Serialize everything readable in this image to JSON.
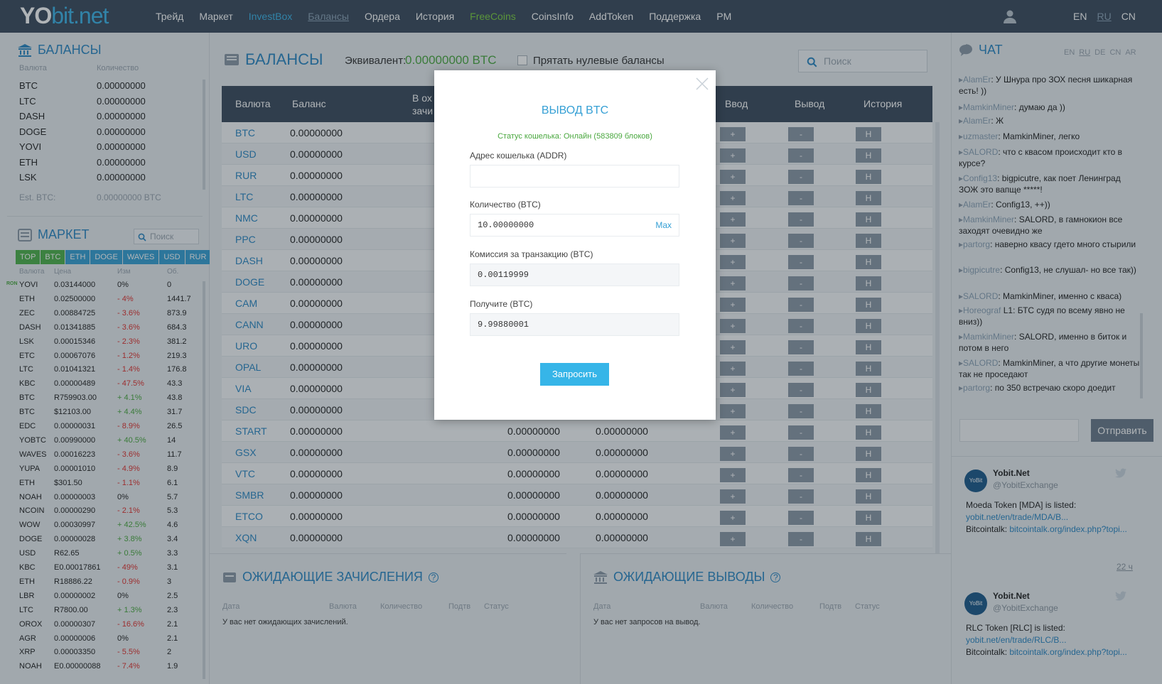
{
  "header": {
    "logo_prefix": "YO",
    "logo_suffix": "bit.net",
    "nav": [
      "Трейд",
      "Маркет",
      "InvestBox",
      "Балансы",
      "Ордера",
      "История",
      "FreeCoins",
      "CoinsInfo",
      "AddToken",
      "Поддержка",
      "PM"
    ],
    "langs": [
      "EN",
      "RU",
      "CN"
    ]
  },
  "balances_panel": {
    "title": "БАЛАНСЫ",
    "col_currency": "Валюта",
    "col_amount": "Количество",
    "rows": [
      {
        "cur": "BTC",
        "amt": "0.00000000"
      },
      {
        "cur": "LTC",
        "amt": "0.00000000"
      },
      {
        "cur": "DASH",
        "amt": "0.00000000"
      },
      {
        "cur": "DOGE",
        "amt": "0.00000000"
      },
      {
        "cur": "YOVI",
        "amt": "0.00000000"
      },
      {
        "cur": "ETH",
        "amt": "0.00000000"
      },
      {
        "cur": "LSK",
        "amt": "0.00000000"
      }
    ],
    "est_label": "Est. BTC:",
    "est_value": "0.00000000 BTC"
  },
  "market_panel": {
    "title": "МАРКЕТ",
    "search_placeholder": "Поиск",
    "tabs": [
      "TOP",
      "BTC",
      "ETH",
      "DOGE",
      "WAVES",
      "USD",
      "RUR"
    ],
    "col_cur": "Валюта",
    "col_price": "Цена",
    "col_change": "Изм",
    "col_vol": "Об.",
    "rows": [
      {
        "cur": "YOVI",
        "price": "0.03144000",
        "chg": "0%",
        "vol": "0"
      },
      {
        "cur": "ETH",
        "price": "0.02500000",
        "chg": "- 4%",
        "vol": "1441.7"
      },
      {
        "cur": "ZEC",
        "price": "0.00884725",
        "chg": "- 3.6%",
        "vol": "873.9"
      },
      {
        "cur": "DASH",
        "price": "0.01341885",
        "chg": "- 3.6%",
        "vol": "684.3"
      },
      {
        "cur": "LSK",
        "price": "0.00015346",
        "chg": "- 2.3%",
        "vol": "381.2"
      },
      {
        "cur": "ETC",
        "price": "0.00067076",
        "chg": "- 1.2%",
        "vol": "219.3"
      },
      {
        "cur": "LTC",
        "price": "0.01041321",
        "chg": "- 1.4%",
        "vol": "176.8"
      },
      {
        "cur": "KBC",
        "price": "0.00000489",
        "chg": "- 47.5%",
        "vol": "43.3"
      },
      {
        "cur": "BTC",
        "price": "R759903.00",
        "chg": "+ 4.1%",
        "vol": "43.8"
      },
      {
        "cur": "BTC",
        "price": "$12103.00",
        "chg": "+ 4.4%",
        "vol": "31.7"
      },
      {
        "cur": "EDC",
        "price": "0.00000031",
        "chg": "- 8.9%",
        "vol": "26.5"
      },
      {
        "cur": "YOBTC",
        "price": "0.00990000",
        "chg": "+ 40.5%",
        "vol": "14"
      },
      {
        "cur": "WAVES",
        "price": "0.00016223",
        "chg": "- 3.6%",
        "vol": "11.7"
      },
      {
        "cur": "YUPA",
        "price": "0.00001010",
        "chg": "- 4.9%",
        "vol": "8.9"
      },
      {
        "cur": "ETH",
        "price": "$301.50",
        "chg": "- 1.1%",
        "vol": "6.1"
      },
      {
        "cur": "NOAH",
        "price": "0.00000003",
        "chg": "0%",
        "vol": "5.7"
      },
      {
        "cur": "NCOIN",
        "price": "0.00000290",
        "chg": "- 2.1%",
        "vol": "5.3"
      },
      {
        "cur": "WOW",
        "price": "0.00030997",
        "chg": "+ 42.5%",
        "vol": "4.6"
      },
      {
        "cur": "DOGE",
        "price": "0.00000028",
        "chg": "+ 3.8%",
        "vol": "3.4"
      },
      {
        "cur": "USD",
        "price": "R62.65",
        "chg": "+ 0.5%",
        "vol": "3.3"
      },
      {
        "cur": "KBC",
        "price": "E0.00017861",
        "chg": "- 49%",
        "vol": "3.1"
      },
      {
        "cur": "ETH",
        "price": "R18886.22",
        "chg": "- 0.9%",
        "vol": "3"
      },
      {
        "cur": "LBR",
        "price": "0.00000002",
        "chg": "0%",
        "vol": "2.5"
      },
      {
        "cur": "LTC",
        "price": "R7800.00",
        "chg": "+ 1.3%",
        "vol": "2.3"
      },
      {
        "cur": "OROX",
        "price": "0.00000307",
        "chg": "- 16.6%",
        "vol": "2.1"
      },
      {
        "cur": "AGR",
        "price": "0.00000006",
        "chg": "0%",
        "vol": "2.1"
      },
      {
        "cur": "XRP",
        "price": "0.00003350",
        "chg": "- 5.5%",
        "vol": "2"
      },
      {
        "cur": "NOAH",
        "price": "E0.00000088",
        "chg": "- 7.4%",
        "vol": "1.9"
      }
    ],
    "ron_badge": "RON"
  },
  "main": {
    "title": "БАЛАНСЫ",
    "equiv_label": "Эквивалент:",
    "equiv_value": "0.00000000 BTC",
    "hide_zero": "Прятать нулевые балансы",
    "search_placeholder": "Поиск",
    "cols": {
      "cur": "Валюта",
      "bal": "Баланс",
      "inorders": "В ох",
      "inorders2": "зачи",
      "dep": "Ввод",
      "wd": "Вывод",
      "hist": "История"
    },
    "btn_plus": "+",
    "btn_minus": "-",
    "btn_hist": "H",
    "rows": [
      {
        "cur": "BTC",
        "bal": "0.00000000",
        "c3": "",
        "c4": ""
      },
      {
        "cur": "USD",
        "bal": "0.00000000",
        "c3": "",
        "c4": ""
      },
      {
        "cur": "RUR",
        "bal": "0.00000000",
        "c3": "",
        "c4": ""
      },
      {
        "cur": "LTC",
        "bal": "0.00000000",
        "c3": "",
        "c4": ""
      },
      {
        "cur": "NMC",
        "bal": "0.00000000",
        "c3": "",
        "c4": ""
      },
      {
        "cur": "PPC",
        "bal": "0.00000000",
        "c3": "",
        "c4": ""
      },
      {
        "cur": "DASH",
        "bal": "0.00000000",
        "c3": "",
        "c4": ""
      },
      {
        "cur": "DOGE",
        "bal": "0.00000000",
        "c3": "",
        "c4": ""
      },
      {
        "cur": "CAM",
        "bal": "0.00000000",
        "c3": "",
        "c4": ""
      },
      {
        "cur": "CANN",
        "bal": "0.00000000",
        "c3": "",
        "c4": ""
      },
      {
        "cur": "URO",
        "bal": "0.00000000",
        "c3": "",
        "c4": ""
      },
      {
        "cur": "OPAL",
        "bal": "0.00000000",
        "c3": "",
        "c4": ""
      },
      {
        "cur": "VIA",
        "bal": "0.00000000",
        "c3": "",
        "c4": ""
      },
      {
        "cur": "SDC",
        "bal": "0.00000000",
        "c3": "",
        "c4": ""
      },
      {
        "cur": "START",
        "bal": "0.00000000",
        "c3": "0.00000000",
        "c4": "0.00000000"
      },
      {
        "cur": "GSX",
        "bal": "0.00000000",
        "c3": "0.00000000",
        "c4": "0.00000000"
      },
      {
        "cur": "VTC",
        "bal": "0.00000000",
        "c3": "0.00000000",
        "c4": "0.00000000"
      },
      {
        "cur": "SMBR",
        "bal": "0.00000000",
        "c3": "0.00000000",
        "c4": "0.00000000"
      },
      {
        "cur": "ETCO",
        "bal": "0.00000000",
        "c3": "0.00000000",
        "c4": "0.00000000"
      },
      {
        "cur": "XQN",
        "bal": "0.00000000",
        "c3": "0.00000000",
        "c4": "0.00000000"
      }
    ]
  },
  "pending_deposits": {
    "title": "ОЖИДАЮЩИЕ ЗАЧИСЛЕНИЯ",
    "cols": [
      "Дата",
      "Валюта",
      "Количество",
      "Подтв",
      "Статус"
    ],
    "empty": "У вас нет ожидающих зачислений."
  },
  "pending_withdrawals": {
    "title": "ОЖИДАЮЩИЕ ВЫВОДЫ",
    "cols": [
      "Дата",
      "Валюта",
      "Количество",
      "Подтв",
      "Статус"
    ],
    "empty": "У вас нет запросов на вывод."
  },
  "modal": {
    "title": "ВЫВОД BTC",
    "status": "Статус кошелька: Онлайн (583809 блоков)",
    "addr_label": "Адрес кошелька (ADDR)",
    "addr_value": "",
    "qty_label": "Количество (BTC)",
    "qty_value": "10.00000000",
    "max_label": "Max",
    "fee_label": "Комиссия за транзакцию (BTC)",
    "fee_value": "0.00119999",
    "recv_label": "Получите (BTC)",
    "recv_value": "9.99880001",
    "submit": "Запросить"
  },
  "chat": {
    "title": "ЧАТ",
    "langs": [
      "EN",
      "RU",
      "DE",
      "CN",
      "AR"
    ],
    "messages": [
      {
        "user": "AlamEr",
        "text": ": У Шнура про ЗОХ песня шикарная есть! ))"
      },
      {
        "user": "MamkinMiner",
        "text": ": думаю да ))"
      },
      {
        "user": "AlamEr",
        "text": ": Ж"
      },
      {
        "user": "uzmaster",
        "text": ": MamkinMiner, легко"
      },
      {
        "user": "SALORD",
        "text": ": что с квасом происходит кто в курсе?"
      },
      {
        "user": "Config13",
        "text": ": bigpicutre, как поет Ленинград ЗОЖ это вапще *****!"
      },
      {
        "user": "AlamEr",
        "text": ": Config13, ++))"
      },
      {
        "user": "MamkinMiner",
        "text": ": SALORD, в гамнокион все заходят очевидно же"
      },
      {
        "user": "partorg",
        "text": ": наверно квасу гдето много стырили"
      },
      {
        "user": "bigpicutre",
        "text": ": Config13, не слушал- но все так))"
      },
      {
        "user": "SALORD",
        "text": ": MamkinMiner, именно с кваса)"
      },
      {
        "user": "Horeograf",
        "text": " L1: БТС судя по всему явно не вниз))"
      },
      {
        "user": "MamkinMiner",
        "text": ": SALORD, именно в биток и потом в него"
      },
      {
        "user": "SALORD",
        "text": ": MamkinMiner, а что другие монеты так не проседают"
      },
      {
        "user": "partorg",
        "text": ": по 350 встречаю скоро доедит"
      }
    ],
    "send": "Отправить"
  },
  "tweets": [
    {
      "name": "Yobit.Net",
      "handle": "@YobitExchange",
      "text": "Moeda Token [MDA] is listed: ",
      "link": "yobit.net/en/trade/MDA/B...",
      "text2": "Bitcointalk: ",
      "link2": "bitcointalk.org/index.php?topi...",
      "time": "22 ч"
    },
    {
      "name": "Yobit.Net",
      "handle": "@YobitExchange",
      "text": "RLC Token [RLC] is listed: ",
      "link": "yobit.net/en/trade/RLC/B...",
      "text2": "Bitcointalk: ",
      "link2": "bitcointalk.org/index.php?topi..."
    }
  ]
}
